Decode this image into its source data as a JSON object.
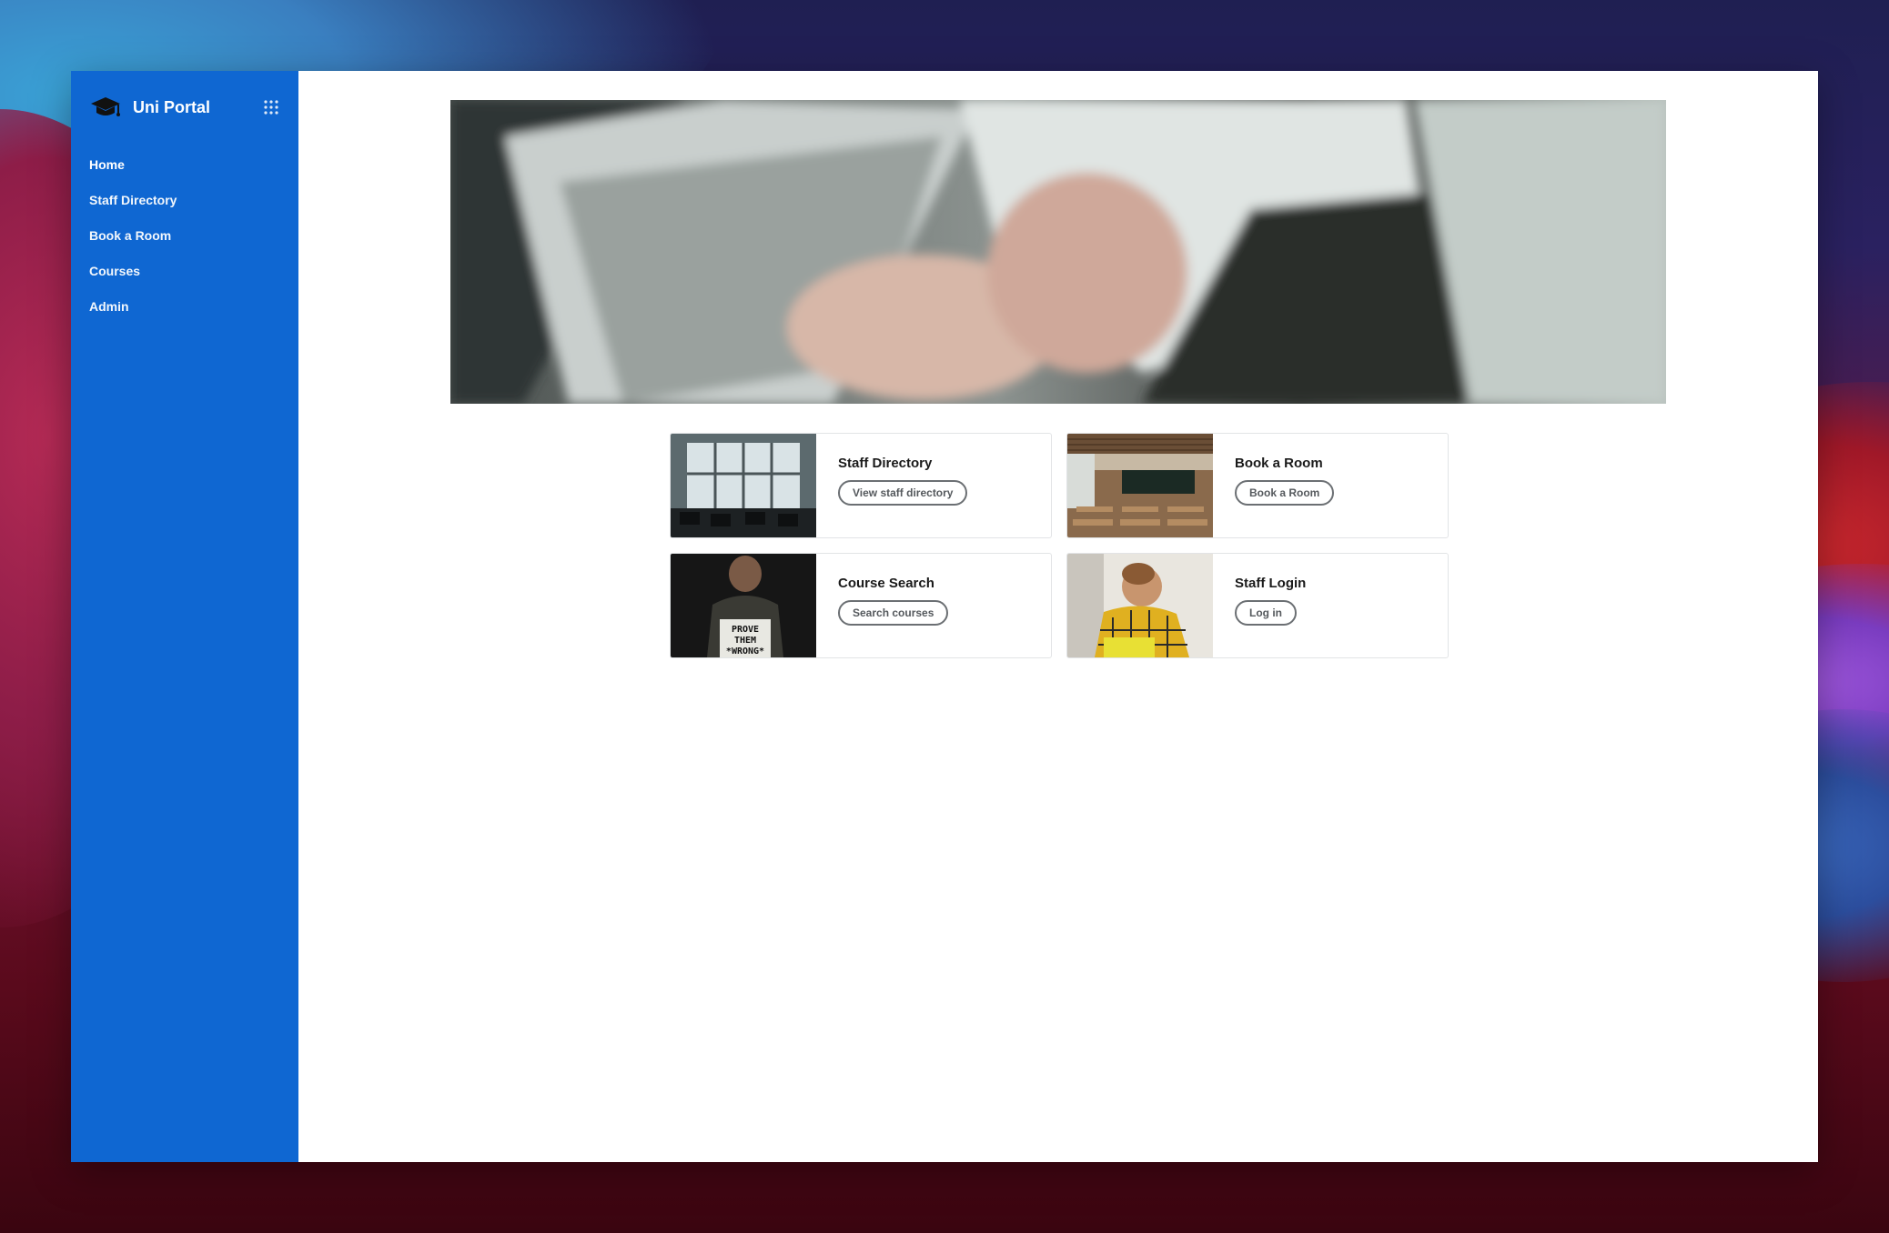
{
  "app": {
    "title": "Uni Portal",
    "brand_color": "#0f67d2",
    "brand_icon": "graduation-cap-icon",
    "menu_icon": "apps-grid-icon"
  },
  "sidebar": {
    "items": [
      {
        "label": "Home",
        "active": true
      },
      {
        "label": "Staff Directory",
        "active": false
      },
      {
        "label": "Book a Room",
        "active": false
      },
      {
        "label": "Courses",
        "active": false
      },
      {
        "label": "Admin",
        "active": false
      }
    ]
  },
  "cards": [
    {
      "title": "Staff Directory",
      "button": "View staff directory",
      "image": "classroom-windows-photo"
    },
    {
      "title": "Book a Room",
      "button": "Book a Room",
      "image": "lecture-room-photo"
    },
    {
      "title": "Course Search",
      "button": "Search courses",
      "image": "prove-them-wrong-photo",
      "image_text": "PROVE THEM *WRONG*"
    },
    {
      "title": "Staff Login",
      "button": "Log in",
      "image": "student-yellow-jacket-photo"
    }
  ]
}
